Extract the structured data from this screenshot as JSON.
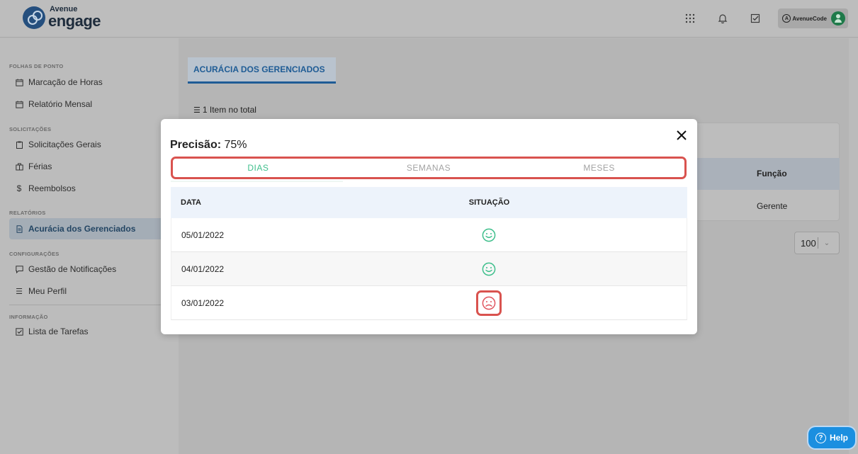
{
  "brand": {
    "line1": "Avenue",
    "line2": "engage"
  },
  "topbar": {
    "icons": [
      "apps-grid-icon",
      "bell-icon",
      "checkbox-icon"
    ],
    "company_logo": "AvenueCode"
  },
  "sidebar": {
    "sections": [
      {
        "title": "FOLHAS DE PONTO",
        "items": [
          {
            "label": "Marcação de Horas",
            "icon": "calendar-icon"
          },
          {
            "label": "Relatório Mensal",
            "icon": "calendar-icon"
          }
        ]
      },
      {
        "title": "SOLICITAÇÕES",
        "items": [
          {
            "label": "Solicitações Gerais",
            "icon": "clipboard-icon"
          },
          {
            "label": "Férias",
            "icon": "briefcase-icon"
          },
          {
            "label": "Reembolsos",
            "icon": "dollar-icon"
          }
        ]
      },
      {
        "title": "RELATÓRIOS",
        "items": [
          {
            "label": "Acurácia dos Gerenciados",
            "icon": "document-icon",
            "active": true
          }
        ]
      },
      {
        "title": "CONFIGURAÇÕES",
        "items": [
          {
            "label": "Gestão de Notificações",
            "icon": "chat-icon"
          },
          {
            "label": "Meu Perfil",
            "icon": "list-icon"
          }
        ]
      },
      {
        "title": "INFORMAÇÃO",
        "items": [
          {
            "label": "Lista de Tarefas",
            "icon": "checkbox-icon"
          }
        ]
      }
    ]
  },
  "page": {
    "tab_label": "ACURÁCIA DOS GERENCIADOS",
    "items_total": "1 Item no total",
    "column_funcao": "Função",
    "cell_gerente": "Gerente",
    "page_size": "100"
  },
  "help": {
    "label": "Help"
  },
  "modal": {
    "precision_label": "Precisão:",
    "precision_value": "75%",
    "tabs": [
      "DIAS",
      "SEMANAS",
      "MESES"
    ],
    "active_tab": 0,
    "table": {
      "headers": [
        "DATA",
        "SITUAÇÃO"
      ],
      "rows": [
        {
          "date": "05/01/2022",
          "status": "happy"
        },
        {
          "date": "04/01/2022",
          "status": "happy"
        },
        {
          "date": "03/01/2022",
          "status": "sad"
        }
      ]
    },
    "colors": {
      "happy": "#3fbf8c",
      "sad": "#e0555f",
      "highlight": "#d9534f"
    }
  }
}
